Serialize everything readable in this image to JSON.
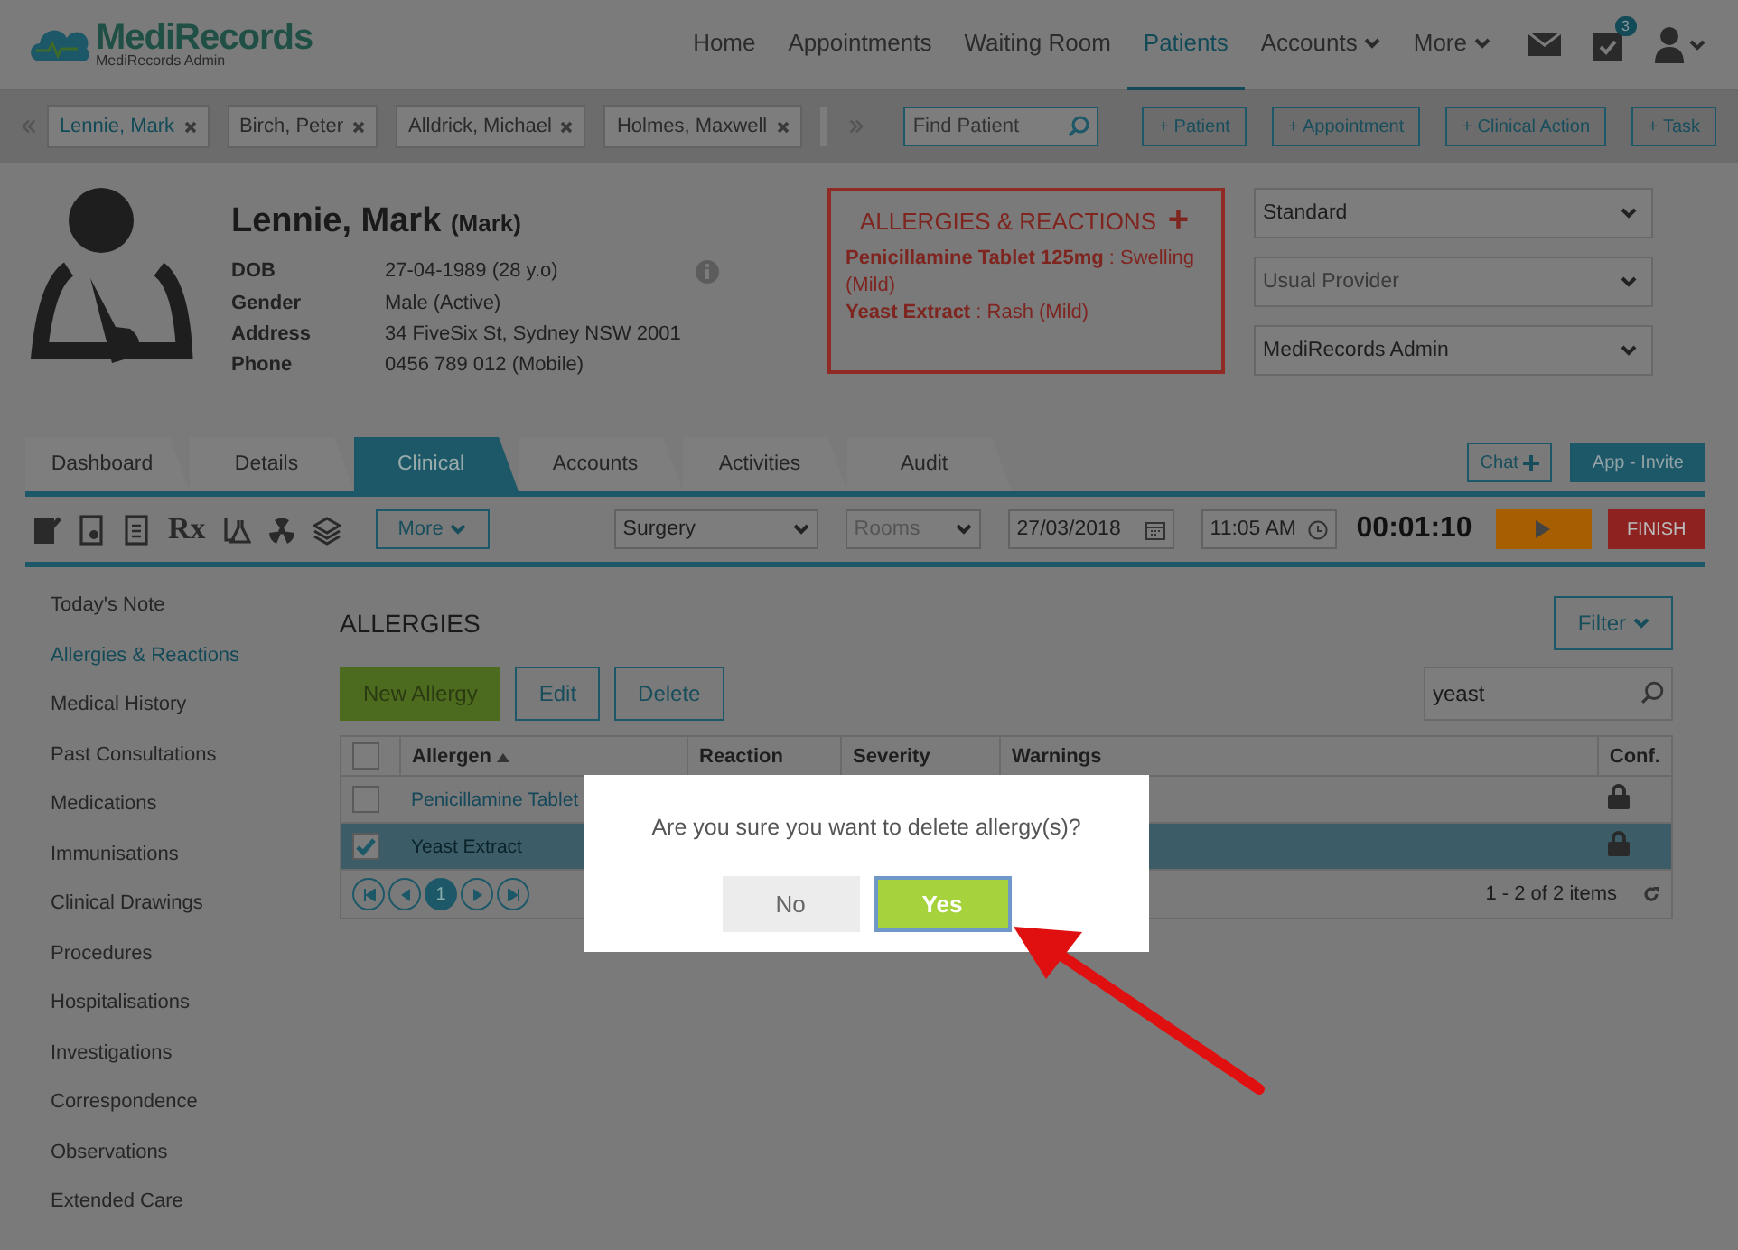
{
  "header": {
    "logo": {
      "name": "MediRecords",
      "subtitle": "MediRecords Admin"
    },
    "nav": [
      {
        "label": "Home",
        "selected": false,
        "dropdown": false
      },
      {
        "label": "Appointments",
        "selected": false,
        "dropdown": false
      },
      {
        "label": "Waiting Room",
        "selected": false,
        "dropdown": false
      },
      {
        "label": "Patients",
        "selected": true,
        "dropdown": false
      },
      {
        "label": "Accounts",
        "selected": false,
        "dropdown": true
      },
      {
        "label": "More",
        "selected": false,
        "dropdown": true
      }
    ],
    "task_badge": "3"
  },
  "patient_tabs": {
    "tabs": [
      {
        "label": "Lennie, Mark",
        "selected": true
      },
      {
        "label": "Birch, Peter",
        "selected": false
      },
      {
        "label": "Alldrick, Michael",
        "selected": false
      },
      {
        "label": "Holmes, Maxwell",
        "selected": false
      }
    ],
    "search": {
      "placeholder": "Find Patient"
    },
    "actions": [
      "+ Patient",
      "+ Appointment",
      "+ Clinical Action",
      "+ Task"
    ]
  },
  "patient": {
    "name": "Lennie, Mark",
    "preferred": "(Mark)",
    "fields": [
      {
        "label": "DOB",
        "value": "27-04-1989 (28 y.o)"
      },
      {
        "label": "Gender",
        "value": "Male (Active)"
      },
      {
        "label": "Address",
        "value": "34 FiveSix St, Sydney NSW 2001"
      },
      {
        "label": "Phone",
        "value": "0456 789 012 (Mobile)"
      }
    ]
  },
  "allergy_summary": {
    "title": "ALLERGIES & REACTIONS",
    "add": "+",
    "items": [
      "**Penicillamine Tablet 125mg** : Swelling (Mild)",
      "**Yeast Extract** : Rash (Mild)"
    ]
  },
  "selects": [
    {
      "value": "Standard"
    },
    {
      "placeholder": "Usual Provider"
    },
    {
      "value": "MediRecords Admin"
    }
  ],
  "clinical_tabs": [
    {
      "label": "Dashboard",
      "selected": false
    },
    {
      "label": "Details",
      "selected": false
    },
    {
      "label": "Clinical",
      "selected": true
    },
    {
      "label": "Accounts",
      "selected": false
    },
    {
      "label": "Activities",
      "selected": false
    },
    {
      "label": "Audit",
      "selected": false
    }
  ],
  "chat_button": "Chat",
  "invite_button": "App - Invite",
  "toolbar": {
    "rx": "Rx",
    "more": "More",
    "location": "Surgery",
    "rooms": {
      "placeholder": "Rooms"
    },
    "date": "27/03/2018",
    "time": "11:05 AM",
    "timer": "00:01:10",
    "finish": "FINISH"
  },
  "sidebar": [
    {
      "label": "Today's Note",
      "selected": false
    },
    {
      "label": "Allergies & Reactions",
      "selected": true
    },
    {
      "label": "Medical History",
      "selected": false
    },
    {
      "label": "Past Consultations",
      "selected": false
    },
    {
      "label": "Medications",
      "selected": false
    },
    {
      "label": "Immunisations",
      "selected": false
    },
    {
      "label": "Clinical Drawings",
      "selected": false
    },
    {
      "label": "Procedures",
      "selected": false
    },
    {
      "label": "Hospitalisations",
      "selected": false
    },
    {
      "label": "Investigations",
      "selected": false
    },
    {
      "label": "Correspondence",
      "selected": false
    },
    {
      "label": "Observations",
      "selected": false
    },
    {
      "label": "Extended Care",
      "selected": false
    }
  ],
  "allergies": {
    "title": "ALLERGIES",
    "filter": "Filter",
    "buttons": [
      {
        "label": "New Allergy",
        "kind": "primary"
      },
      {
        "label": "Edit",
        "kind": "outline"
      },
      {
        "label": "Delete",
        "kind": "outline"
      }
    ],
    "search": {
      "value": "yeast"
    },
    "all_checked": false,
    "columns": [
      "Allergen",
      "Reaction",
      "Severity",
      "Warnings",
      "Conf."
    ],
    "rows": [
      {
        "allergen": "Penicillamine Tablet",
        "selected": false,
        "checked": false
      },
      {
        "allergen": "Yeast Extract",
        "selected": true,
        "checked": true
      }
    ],
    "page": "1",
    "summary": "1 - 2 of 2 items"
  },
  "dialog": {
    "message": "Are you sure you want to delete allergy(s)?",
    "buttons": [
      {
        "label": "No",
        "kind": "secondary"
      },
      {
        "label": "Yes",
        "kind": "primary"
      }
    ]
  }
}
